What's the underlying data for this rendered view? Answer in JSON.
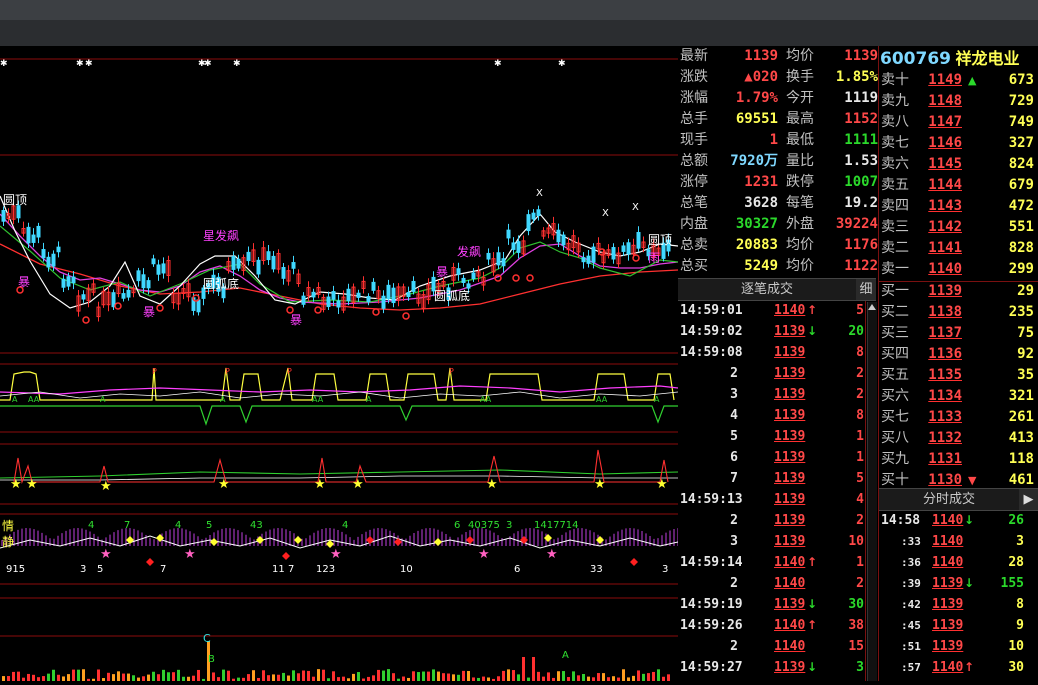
{
  "quote": {
    "rows": [
      {
        "l1": "最新",
        "v1": "1139",
        "c1": "red",
        "l2": "均价",
        "v2": "1139",
        "c2": "red"
      },
      {
        "l1": "涨跌",
        "v1": "▲020",
        "c1": "red",
        "l2": "换手",
        "v2": "1.85%",
        "c2": "yel"
      },
      {
        "l1": "涨幅",
        "v1": "1.79%",
        "c1": "red",
        "l2": "今开",
        "v2": "1119",
        "c2": "wht"
      },
      {
        "l1": "总手",
        "v1": "69551",
        "c1": "yel",
        "l2": "最高",
        "v2": "1152",
        "c2": "red"
      },
      {
        "l1": "现手",
        "v1": "1",
        "c1": "red",
        "l2": "最低",
        "v2": "1111",
        "c2": "grn"
      },
      {
        "l1": "总额",
        "v1": "7920万",
        "c1": "cyan",
        "l2": "量比",
        "v2": "1.53",
        "c2": "wht"
      },
      {
        "l1": "涨停",
        "v1": "1231",
        "c1": "red",
        "l2": "跌停",
        "v2": "1007",
        "c2": "grn"
      },
      {
        "l1": "总笔",
        "v1": "3628",
        "c1": "wht",
        "l2": "每笔",
        "v2": "19.2",
        "c2": "wht"
      },
      {
        "l1": "内盘",
        "v1": "30327",
        "c1": "grn",
        "l2": "外盘",
        "v2": "39224",
        "c2": "red"
      },
      {
        "l1": "总卖",
        "v1": "20883",
        "c1": "yel",
        "l2": "均价",
        "v2": "1176",
        "c2": "red"
      },
      {
        "l1": "总买",
        "v1": "5249",
        "c1": "yel",
        "l2": "均价",
        "v2": "1122",
        "c2": "red"
      }
    ]
  },
  "stock": {
    "code": "600769",
    "name": "祥龙电业"
  },
  "asks": [
    {
      "label": "卖十",
      "price": "1149",
      "vol": "673",
      "mark": "▲"
    },
    {
      "label": "卖九",
      "price": "1148",
      "vol": "729",
      "mark": ""
    },
    {
      "label": "卖八",
      "price": "1147",
      "vol": "749",
      "mark": ""
    },
    {
      "label": "卖七",
      "price": "1146",
      "vol": "327",
      "mark": ""
    },
    {
      "label": "卖六",
      "price": "1145",
      "vol": "824",
      "mark": ""
    },
    {
      "label": "卖五",
      "price": "1144",
      "vol": "679",
      "mark": ""
    },
    {
      "label": "卖四",
      "price": "1143",
      "vol": "472",
      "mark": ""
    },
    {
      "label": "卖三",
      "price": "1142",
      "vol": "551",
      "mark": ""
    },
    {
      "label": "卖二",
      "price": "1141",
      "vol": "828",
      "mark": ""
    },
    {
      "label": "卖一",
      "price": "1140",
      "vol": "299",
      "mark": ""
    }
  ],
  "bids": [
    {
      "label": "买一",
      "price": "1139",
      "vol": "29",
      "mark": ""
    },
    {
      "label": "买二",
      "price": "1138",
      "vol": "235",
      "mark": ""
    },
    {
      "label": "买三",
      "price": "1137",
      "vol": "75",
      "mark": ""
    },
    {
      "label": "买四",
      "price": "1136",
      "vol": "92",
      "mark": ""
    },
    {
      "label": "买五",
      "price": "1135",
      "vol": "35",
      "mark": ""
    },
    {
      "label": "买六",
      "price": "1134",
      "vol": "321",
      "mark": ""
    },
    {
      "label": "买七",
      "price": "1133",
      "vol": "261",
      "mark": ""
    },
    {
      "label": "买八",
      "price": "1132",
      "vol": "413",
      "mark": ""
    },
    {
      "label": "买九",
      "price": "1131",
      "vol": "118",
      "mark": ""
    },
    {
      "label": "买十",
      "price": "1130",
      "vol": "461",
      "mark": "▼"
    }
  ],
  "ticks": {
    "title": "逐笔成交",
    "detail": "细",
    "rows": [
      {
        "t": "14:59:01",
        "p": "1140",
        "d": "up",
        "v": "5"
      },
      {
        "t": "14:59:02",
        "p": "1139",
        "d": "down",
        "v": "20"
      },
      {
        "t": "14:59:08",
        "p": "1139",
        "d": "",
        "v": "8"
      },
      {
        "t": "2",
        "p": "1139",
        "d": "",
        "v": "2"
      },
      {
        "t": "3",
        "p": "1139",
        "d": "",
        "v": "2"
      },
      {
        "t": "4",
        "p": "1139",
        "d": "",
        "v": "8"
      },
      {
        "t": "5",
        "p": "1139",
        "d": "",
        "v": "1"
      },
      {
        "t": "6",
        "p": "1139",
        "d": "",
        "v": "1"
      },
      {
        "t": "7",
        "p": "1139",
        "d": "",
        "v": "5"
      },
      {
        "t": "14:59:13",
        "p": "1139",
        "d": "",
        "v": "4"
      },
      {
        "t": "2",
        "p": "1139",
        "d": "",
        "v": "2"
      },
      {
        "t": "3",
        "p": "1139",
        "d": "",
        "v": "10"
      },
      {
        "t": "14:59:14",
        "p": "1140",
        "d": "up",
        "v": "1"
      },
      {
        "t": "2",
        "p": "1140",
        "d": "",
        "v": "2"
      },
      {
        "t": "14:59:19",
        "p": "1139",
        "d": "down",
        "v": "30"
      },
      {
        "t": "14:59:26",
        "p": "1140",
        "d": "up",
        "v": "38"
      },
      {
        "t": "2",
        "p": "1140",
        "d": "",
        "v": "15"
      },
      {
        "t": "14:59:27",
        "p": "1139",
        "d": "down",
        "v": "3"
      }
    ]
  },
  "minute": {
    "title": "分时成交",
    "rows": [
      {
        "t": "14:58",
        "p": "1140",
        "d": "down",
        "v": "26"
      },
      {
        "t": ":33",
        "p": "1140",
        "d": "",
        "v": "3"
      },
      {
        "t": ":36",
        "p": "1140",
        "d": "",
        "v": "28"
      },
      {
        "t": ":39",
        "p": "1139",
        "d": "down",
        "v": "155"
      },
      {
        "t": ":42",
        "p": "1139",
        "d": "",
        "v": "8"
      },
      {
        "t": ":45",
        "p": "1139",
        "d": "",
        "v": "9"
      },
      {
        "t": ":51",
        "p": "1139",
        "d": "",
        "v": "10"
      },
      {
        "t": ":57",
        "p": "1140",
        "d": "up",
        "v": "30"
      }
    ]
  },
  "chart_labels": {
    "yuanding1": "圆顶",
    "yuanding2": "圆顶",
    "yuanhudi1": "圆弧底",
    "yuanhudi2": "圆弧底",
    "xingfabiao": "星发飙",
    "fabiao": "发飙",
    "bao1": "暴",
    "bao2": "暴",
    "bao3": "暴",
    "bao4": "暴",
    "yu": "雨",
    "x1": "X",
    "x2": "X",
    "x3": "X",
    "n915": "915",
    "n3": "3",
    "n5": "5",
    "n7": "7",
    "n11": "11",
    "n7b": "7",
    "n123": "123",
    "n10": "10",
    "n6": "6",
    "n33": "33",
    "n3b": "3",
    "t4": "4",
    "t7": "7",
    "t4b": "4",
    "t5": "5",
    "t43": "43",
    "t4c": "4",
    "t6": "6",
    "t40375": "40375",
    "t3": "3",
    "t1417714": "1417714",
    "qing": "情",
    "jing": "静",
    "cmark": "C",
    "bmark": "B",
    "amark": "A"
  },
  "colors": {
    "up": "#ff4848",
    "down": "#2bd92b",
    "grid": "#7a1010"
  }
}
